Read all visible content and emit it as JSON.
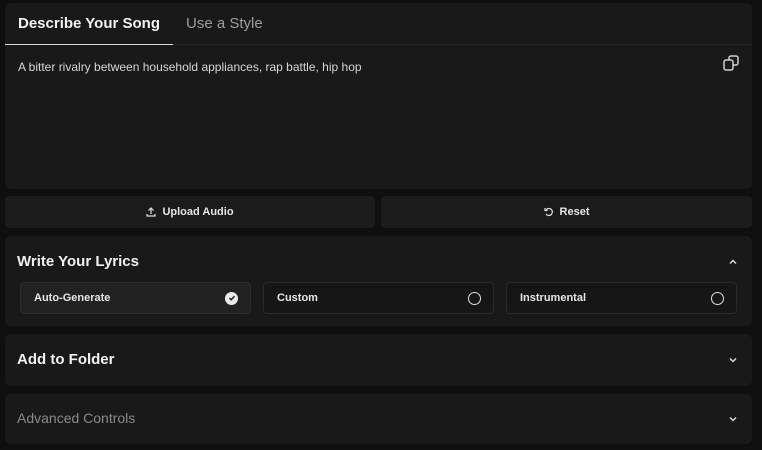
{
  "tabs": [
    {
      "label": "Describe Your Song",
      "active": true
    },
    {
      "label": "Use a Style",
      "active": false
    }
  ],
  "prompt": {
    "text": "A bitter rivalry between household appliances, rap battle, hip hop",
    "icon": "copy-icon"
  },
  "actions": {
    "upload_label": "Upload Audio",
    "reset_label": "Reset"
  },
  "lyrics": {
    "title": "Write Your Lyrics",
    "expanded": true,
    "options": [
      {
        "label": "Auto-Generate",
        "selected": true
      },
      {
        "label": "Custom",
        "selected": false
      },
      {
        "label": "Instrumental",
        "selected": false
      }
    ]
  },
  "folder": {
    "title": "Add to Folder",
    "expanded": false
  },
  "advanced": {
    "title": "Advanced Controls",
    "expanded": false
  },
  "colors": {
    "background": "#0f0f0f",
    "panel": "#191919",
    "text": "#e8e8e8",
    "muted": "#8a8a8a"
  }
}
